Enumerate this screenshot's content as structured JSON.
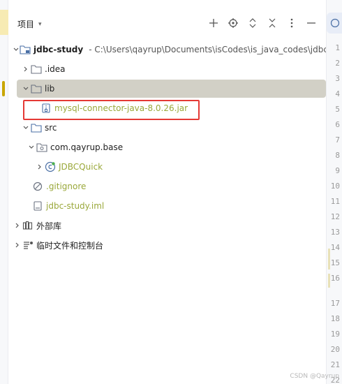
{
  "panel": {
    "title": "项目",
    "toolbar": [
      {
        "name": "add-icon",
        "glyph": "+"
      },
      {
        "name": "locate-icon",
        "glyph": "⊕"
      },
      {
        "name": "expand-all-icon",
        "glyph": "⌃"
      },
      {
        "name": "collapse-all-icon",
        "glyph": "✕"
      },
      {
        "name": "more-options-icon",
        "glyph": "⋮"
      },
      {
        "name": "minimize-icon",
        "glyph": "—"
      }
    ]
  },
  "tree": {
    "project": {
      "name": "jdbc-study",
      "path": "- C:\\Users\\qayrup\\Documents\\isCodes\\is_java_codes\\jdbc-stud"
    },
    "idea": ".idea",
    "lib": "lib",
    "jar": "mysql-connector-java-8.0.26.jar",
    "src": "src",
    "package": "com.qayrup.base",
    "class": "JDBCQuick",
    "gitignore": ".gitignore",
    "iml": "jdbc-study.iml",
    "external_libs": "外部库",
    "scratches": "临时文件和控制台"
  },
  "gutter": {
    "lines": [
      "1",
      "2",
      "3",
      "4",
      "5",
      "6",
      "7",
      "8",
      "9",
      "10",
      "11",
      "12",
      "13",
      "14",
      "15",
      "16",
      "17",
      "18",
      "19",
      "20",
      "21",
      "22"
    ]
  },
  "watermark": "CSDN @Qayrup",
  "colors": {
    "selection": "#d2d0c6",
    "highlight": "#e53935",
    "jar_text": "#9aa83a",
    "accent": "#c9a600"
  }
}
